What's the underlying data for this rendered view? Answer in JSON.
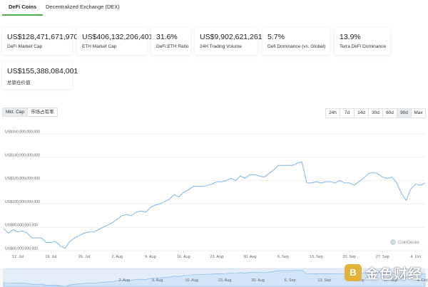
{
  "tabs": [
    {
      "label": "DeFi Coins",
      "active": true
    },
    {
      "label": "Decentralized Exchange (DEX)",
      "active": false
    }
  ],
  "stats": [
    {
      "value": "US$128,471,671,970",
      "label": "DeFi Market Cap"
    },
    {
      "value": "US$406,132,206,401",
      "label": "ETH Market Cap"
    },
    {
      "value": "31.6%",
      "label": "DeFi:ETH Ratio"
    },
    {
      "value": "US$9,902,621,261",
      "label": "24H Trading Volume"
    },
    {
      "value": "5.7%",
      "label": "Defi Dominance (vs. Global)"
    },
    {
      "value": "13.9%",
      "label": "Terra DeFi Dominance"
    },
    {
      "value": "US$155,388,084,001",
      "label": "总锁仓价值"
    }
  ],
  "view_toggle": {
    "options": [
      "Mkt. Cap",
      "市场占有率"
    ],
    "selected": "Mkt. Cap"
  },
  "range_buttons": [
    "24h",
    "7d",
    "14d",
    "30d",
    "60d",
    "90d",
    "Max"
  ],
  "range_selected": "90d",
  "colors": {
    "accent": "#4caf50",
    "line": "#7cb5ec",
    "navigator_fill": "#d2e4f7"
  },
  "chart_data": {
    "type": "line",
    "ylim": [
      60000000000,
      160000000000
    ],
    "yticks": [
      {
        "value": 60000000000,
        "label": "US$60,000,000,000"
      },
      {
        "value": 80000000000,
        "label": "US$80,000,000,000"
      },
      {
        "value": 100000000000,
        "label": "US$100,000,000,000"
      },
      {
        "value": 120000000000,
        "label": "US$120,000,000,000"
      },
      {
        "value": 140000000000,
        "label": "US$140,000,000,000"
      },
      {
        "value": 160000000000,
        "label": "US$160,000,000,000"
      }
    ],
    "xticks": [
      {
        "date": "2021-07-12",
        "label": "12. Jul"
      },
      {
        "date": "2021-07-19",
        "label": "19. Jul"
      },
      {
        "date": "2021-07-26",
        "label": "26. Jul"
      },
      {
        "date": "2021-08-02",
        "label": "2. Aug"
      },
      {
        "date": "2021-08-09",
        "label": "9. Aug"
      },
      {
        "date": "2021-08-16",
        "label": "16. Aug"
      },
      {
        "date": "2021-08-23",
        "label": "23. Aug"
      },
      {
        "date": "2021-08-30",
        "label": "30. Aug"
      },
      {
        "date": "2021-09-06",
        "label": "6. Sep"
      },
      {
        "date": "2021-09-13",
        "label": "13. Sep"
      },
      {
        "date": "2021-09-20",
        "label": "20. Sep"
      },
      {
        "date": "2021-09-27",
        "label": "27. Sep"
      },
      {
        "date": "2021-10-04",
        "label": "4. Oct"
      }
    ],
    "x": [
      "2021-07-09",
      "2021-07-10",
      "2021-07-11",
      "2021-07-12",
      "2021-07-13",
      "2021-07-14",
      "2021-07-15",
      "2021-07-16",
      "2021-07-17",
      "2021-07-18",
      "2021-07-19",
      "2021-07-20",
      "2021-07-21",
      "2021-07-22",
      "2021-07-23",
      "2021-07-24",
      "2021-07-25",
      "2021-07-26",
      "2021-07-27",
      "2021-07-28",
      "2021-07-29",
      "2021-07-30",
      "2021-07-31",
      "2021-08-01",
      "2021-08-02",
      "2021-08-03",
      "2021-08-04",
      "2021-08-05",
      "2021-08-06",
      "2021-08-07",
      "2021-08-08",
      "2021-08-09",
      "2021-08-10",
      "2021-08-11",
      "2021-08-12",
      "2021-08-13",
      "2021-08-14",
      "2021-08-15",
      "2021-08-16",
      "2021-08-17",
      "2021-08-18",
      "2021-08-19",
      "2021-08-20",
      "2021-08-21",
      "2021-08-22",
      "2021-08-23",
      "2021-08-24",
      "2021-08-25",
      "2021-08-26",
      "2021-08-27",
      "2021-08-28",
      "2021-08-29",
      "2021-08-30",
      "2021-08-31",
      "2021-09-01",
      "2021-09-02",
      "2021-09-03",
      "2021-09-04",
      "2021-09-05",
      "2021-09-06",
      "2021-09-07",
      "2021-09-08",
      "2021-09-09",
      "2021-09-10",
      "2021-09-11",
      "2021-09-12",
      "2021-09-13",
      "2021-09-14",
      "2021-09-15",
      "2021-09-16",
      "2021-09-17",
      "2021-09-18",
      "2021-09-19",
      "2021-09-20",
      "2021-09-21",
      "2021-09-22",
      "2021-09-23",
      "2021-09-24",
      "2021-09-25",
      "2021-09-26",
      "2021-09-27",
      "2021-09-28",
      "2021-09-29",
      "2021-09-30",
      "2021-10-01",
      "2021-10-02",
      "2021-10-03",
      "2021-10-04",
      "2021-10-05",
      "2021-10-06"
    ],
    "series": [
      {
        "values": [
          79,
          75,
          78,
          76,
          77,
          75,
          71,
          71,
          71,
          67,
          67,
          68,
          64,
          62,
          68,
          71,
          73,
          75,
          76,
          76,
          78,
          80,
          82,
          84,
          87,
          90,
          91,
          90,
          93,
          94,
          93,
          97,
          99,
          100,
          102,
          104,
          108,
          106,
          110,
          112,
          115,
          115,
          115,
          116,
          117,
          119,
          119,
          120,
          122,
          120,
          124,
          122,
          125,
          125,
          124,
          123,
          126,
          129,
          133,
          133,
          133,
          133,
          135,
          136,
          118,
          118,
          119,
          118,
          119,
          119,
          118,
          120,
          118,
          118,
          116,
          119,
          122,
          126,
          127,
          126,
          123,
          122,
          123,
          118,
          109,
          103,
          113,
          117,
          116,
          118
        ]
      }
    ]
  },
  "navigator": {
    "labels": [
      "2. Aug",
      "9. Aug",
      "16. Aug",
      "23. Aug",
      "30. Aug",
      "6. Sep",
      "13. Sep",
      "20. Sep",
      "27. Sep",
      "4. Oct"
    ]
  },
  "credit": "CoinGecko",
  "watermark": {
    "logo_text": "B",
    "text": "金色财经"
  }
}
